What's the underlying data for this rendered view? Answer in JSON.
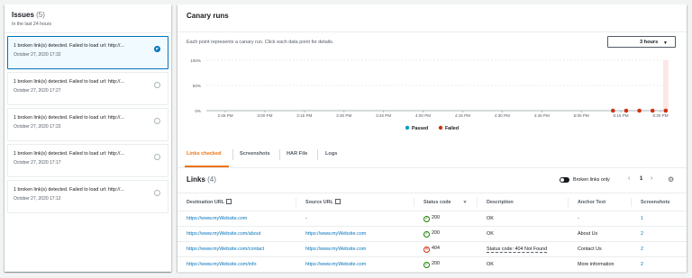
{
  "issues": {
    "title": "Issues",
    "count": "(5)",
    "subtitle": "In the last 24 hours",
    "items": [
      {
        "text": "1 broken link(s) detected. Failed to load url: http://...",
        "date": "October 27, 2020 17:32",
        "selected": true
      },
      {
        "text": "1 broken link(s) detected. Failed to load url: http://...",
        "date": "October 27, 2020 17:27",
        "selected": false
      },
      {
        "text": "1 broken link(s) detected. Failed to load url: http://...",
        "date": "October 27, 2020 17:22",
        "selected": false
      },
      {
        "text": "1 broken link(s) detected. Failed to load url: http://...",
        "date": "October 27, 2020 17:17",
        "selected": false
      },
      {
        "text": "1 broken link(s) detected. Failed to load url: http://...",
        "date": "October 27, 2020 17:12",
        "selected": false
      }
    ]
  },
  "canary": {
    "title": "Canary runs",
    "description": "Each point represents a canary run. Click each data point for details.",
    "range_label": "3 hours",
    "caret": "▼"
  },
  "chart_data": {
    "type": "scatter",
    "y_ticks": [
      "100%",
      "50%",
      "0%"
    ],
    "x_ticks": [
      "2:45 PM",
      "3:00 PM",
      "3:15 PM",
      "3:30 PM",
      "3:45 PM",
      "4:00 PM",
      "4:15 PM",
      "4:30 PM",
      "4:45 PM",
      "5:00 PM",
      "5:15 PM",
      "5:30 PM"
    ],
    "ylim": [
      0,
      100
    ],
    "legend": [
      "Passed",
      "Failed"
    ],
    "legend_position": "bottom",
    "colors": {
      "passed": "#00a1c9",
      "failed": "#d13212",
      "highlight": "#fde6e6"
    },
    "series": [
      {
        "name": "Failed",
        "points": [
          {
            "x": "5:12 PM",
            "y": 0
          },
          {
            "x": "5:17 PM",
            "y": 0
          },
          {
            "x": "5:22 PM",
            "y": 0
          },
          {
            "x": "5:27 PM",
            "y": 0
          },
          {
            "x": "5:32 PM",
            "y": 0
          }
        ]
      }
    ]
  },
  "tabs": [
    "Links checked",
    "Screenshots",
    "HAR File",
    "Logs"
  ],
  "links": {
    "title": "Links",
    "count": "(4)",
    "toggle_label": "Broken links only",
    "page": "1",
    "prev": "‹",
    "next": "›",
    "settings_icon": "⚙",
    "columns": [
      "Destination URL",
      "Source URL",
      "Status code",
      "Description",
      "Anchor Text",
      "Screenshots"
    ],
    "sort_icon": "▿",
    "rows": [
      {
        "dest": "https://www.myWebsite.com",
        "source": "-",
        "status": "200",
        "ok": true,
        "description": "OK",
        "anchor": "-",
        "screenshots": "1"
      },
      {
        "dest": "https://www.myWebsite.com/about",
        "source": "https://www.myWebsite.com",
        "status": "200",
        "ok": true,
        "description": "OK",
        "anchor": "About Us",
        "screenshots": "2"
      },
      {
        "dest": "https://www.myWebsite.com/contact",
        "source": "https://www.myWebsite.com",
        "status": "404",
        "ok": false,
        "description": "Status code: 404 Not Found",
        "anchor": "Contact Us",
        "screenshots": "2"
      },
      {
        "dest": "https://www.myWebsite.com/info",
        "source": "https://www.myWebsite.com",
        "status": "200",
        "ok": true,
        "description": "OK",
        "anchor": "More information",
        "screenshots": "2"
      }
    ]
  }
}
